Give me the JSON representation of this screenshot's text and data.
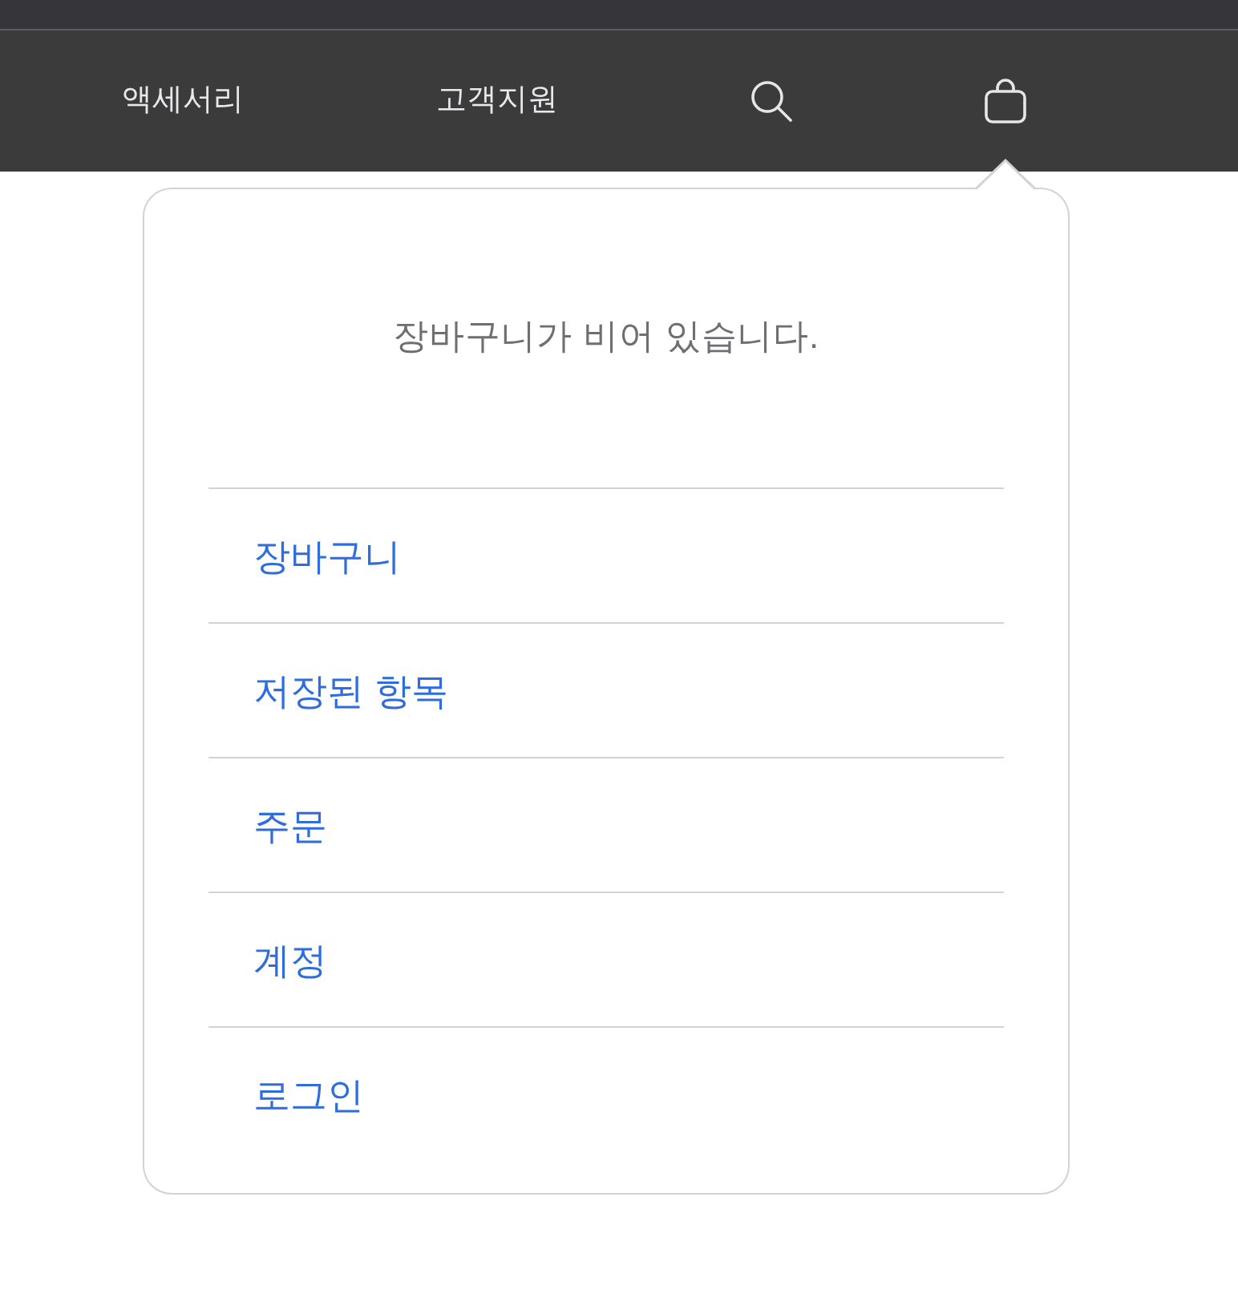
{
  "nav": {
    "items": [
      {
        "kind": "link",
        "label": "액세서리"
      },
      {
        "kind": "link",
        "label": "고객지원"
      },
      {
        "kind": "search"
      },
      {
        "kind": "bag"
      }
    ]
  },
  "bag_popover": {
    "message": "장바구니가 비어 있습니다.",
    "links": [
      "장바구니",
      "저장된 항목",
      "주문",
      "계정",
      "로그인"
    ]
  }
}
